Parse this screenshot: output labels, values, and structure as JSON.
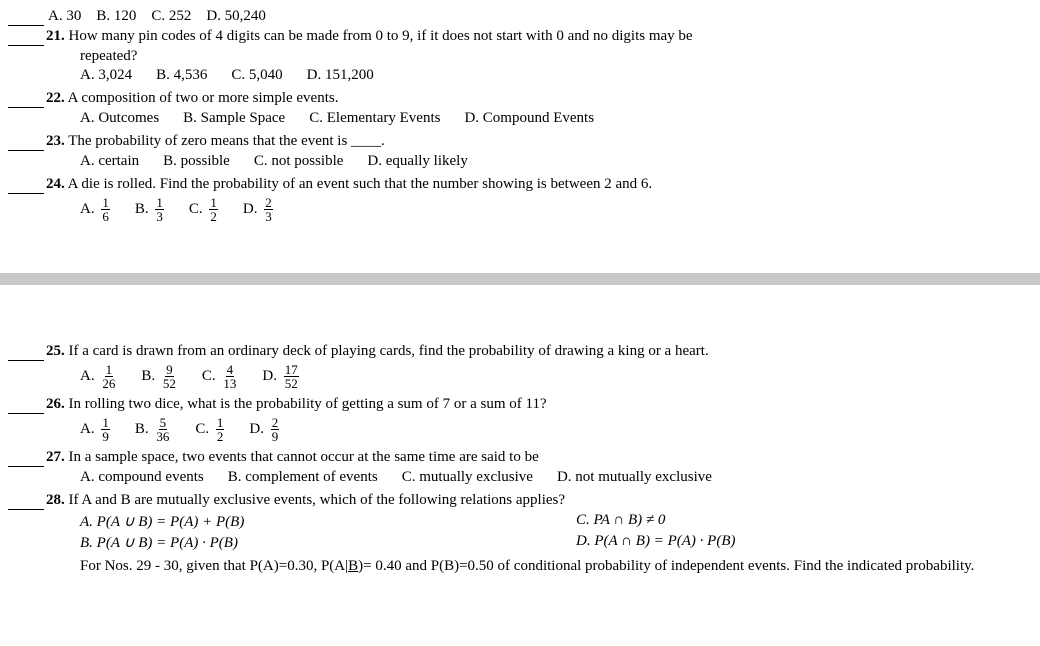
{
  "questions": [
    {
      "num": "21.",
      "text": "How many pin codes of 4 digits can be made from 0 to 9, if it does not start with 0 and no digits may be repeated?",
      "choices": [
        {
          "label": "A. 3,024"
        },
        {
          "label": "B. 4,536"
        },
        {
          "label": "C. 5,040"
        },
        {
          "label": "D. 151,200"
        }
      ]
    },
    {
      "num": "22.",
      "text": "A composition of two or more simple events.",
      "choices": [
        {
          "label": "A. Outcomes"
        },
        {
          "label": "B. Sample Space"
        },
        {
          "label": "C. Elementary Events"
        },
        {
          "label": "D. Compound Events"
        }
      ]
    },
    {
      "num": "23.",
      "text": "The probability of zero means that the event is ____.",
      "choices": [
        {
          "label": "A. certain"
        },
        {
          "label": "B. possible"
        },
        {
          "label": "C. not possible"
        },
        {
          "label": "D. equally likely"
        }
      ]
    },
    {
      "num": "24.",
      "text": "A die is rolled. Find the probability of an event such that the number showing is between 2 and 6.",
      "choices_frac": true
    }
  ],
  "questions_bottom": [
    {
      "num": "25.",
      "text": "If a card is drawn from an ordinary deck of playing cards, find the probability of drawing a king or a heart.",
      "choices_frac": true,
      "frac_choices": [
        {
          "label": "A.",
          "num": "1",
          "den": "26"
        },
        {
          "label": "B.",
          "num": "9",
          "den": "52"
        },
        {
          "label": "C.",
          "num": "4",
          "den": "13"
        },
        {
          "label": "D.",
          "num": "17",
          "den": "52"
        }
      ]
    },
    {
      "num": "26.",
      "text": "In rolling two dice, what is the probability of getting a sum of 7 or a sum of 11?",
      "frac_choices": [
        {
          "label": "A.",
          "num": "1",
          "den": "9"
        },
        {
          "label": "B.",
          "num": "5",
          "den": "36"
        },
        {
          "label": "C.",
          "num": "1",
          "den": "2"
        },
        {
          "label": "D.",
          "num": "2",
          "den": "9"
        }
      ]
    },
    {
      "num": "27.",
      "text": "In a sample space, two events that cannot occur at the same time are said to be",
      "choices": [
        {
          "label": "A. compound events"
        },
        {
          "label": "B. complement of events"
        },
        {
          "label": "C. mutually exclusive"
        },
        {
          "label": "D. not mutually exclusive"
        }
      ]
    },
    {
      "num": "28.",
      "text": "If A and B are mutually exclusive events, which of the following relations applies?",
      "choices_math": true
    }
  ],
  "note": {
    "text": "For Nos. 29 - 30, given that P(A)=0.30, P(A|B)= 0.40 and P(B)=0.50 of conditional probability of independent events. Find the indicated probability."
  }
}
